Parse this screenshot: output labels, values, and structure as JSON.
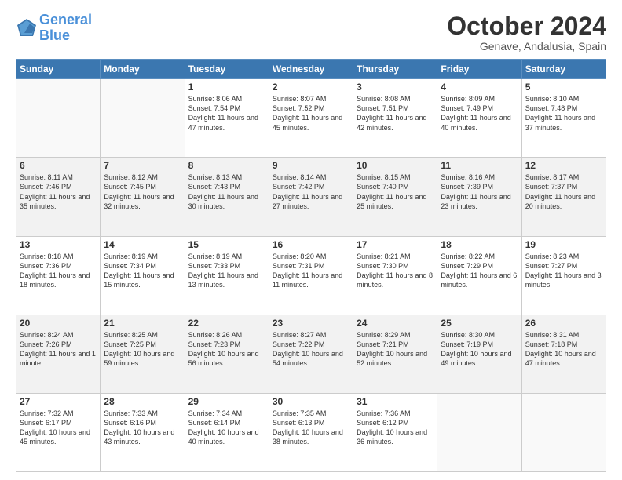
{
  "header": {
    "logo_line1": "General",
    "logo_line2": "Blue",
    "month_title": "October 2024",
    "subtitle": "Genave, Andalusia, Spain"
  },
  "weekdays": [
    "Sunday",
    "Monday",
    "Tuesday",
    "Wednesday",
    "Thursday",
    "Friday",
    "Saturday"
  ],
  "weeks": [
    [
      {
        "day": "",
        "info": ""
      },
      {
        "day": "",
        "info": ""
      },
      {
        "day": "1",
        "info": "Sunrise: 8:06 AM\nSunset: 7:54 PM\nDaylight: 11 hours and 47 minutes."
      },
      {
        "day": "2",
        "info": "Sunrise: 8:07 AM\nSunset: 7:52 PM\nDaylight: 11 hours and 45 minutes."
      },
      {
        "day": "3",
        "info": "Sunrise: 8:08 AM\nSunset: 7:51 PM\nDaylight: 11 hours and 42 minutes."
      },
      {
        "day": "4",
        "info": "Sunrise: 8:09 AM\nSunset: 7:49 PM\nDaylight: 11 hours and 40 minutes."
      },
      {
        "day": "5",
        "info": "Sunrise: 8:10 AM\nSunset: 7:48 PM\nDaylight: 11 hours and 37 minutes."
      }
    ],
    [
      {
        "day": "6",
        "info": "Sunrise: 8:11 AM\nSunset: 7:46 PM\nDaylight: 11 hours and 35 minutes."
      },
      {
        "day": "7",
        "info": "Sunrise: 8:12 AM\nSunset: 7:45 PM\nDaylight: 11 hours and 32 minutes."
      },
      {
        "day": "8",
        "info": "Sunrise: 8:13 AM\nSunset: 7:43 PM\nDaylight: 11 hours and 30 minutes."
      },
      {
        "day": "9",
        "info": "Sunrise: 8:14 AM\nSunset: 7:42 PM\nDaylight: 11 hours and 27 minutes."
      },
      {
        "day": "10",
        "info": "Sunrise: 8:15 AM\nSunset: 7:40 PM\nDaylight: 11 hours and 25 minutes."
      },
      {
        "day": "11",
        "info": "Sunrise: 8:16 AM\nSunset: 7:39 PM\nDaylight: 11 hours and 23 minutes."
      },
      {
        "day": "12",
        "info": "Sunrise: 8:17 AM\nSunset: 7:37 PM\nDaylight: 11 hours and 20 minutes."
      }
    ],
    [
      {
        "day": "13",
        "info": "Sunrise: 8:18 AM\nSunset: 7:36 PM\nDaylight: 11 hours and 18 minutes."
      },
      {
        "day": "14",
        "info": "Sunrise: 8:19 AM\nSunset: 7:34 PM\nDaylight: 11 hours and 15 minutes."
      },
      {
        "day": "15",
        "info": "Sunrise: 8:19 AM\nSunset: 7:33 PM\nDaylight: 11 hours and 13 minutes."
      },
      {
        "day": "16",
        "info": "Sunrise: 8:20 AM\nSunset: 7:31 PM\nDaylight: 11 hours and 11 minutes."
      },
      {
        "day": "17",
        "info": "Sunrise: 8:21 AM\nSunset: 7:30 PM\nDaylight: 11 hours and 8 minutes."
      },
      {
        "day": "18",
        "info": "Sunrise: 8:22 AM\nSunset: 7:29 PM\nDaylight: 11 hours and 6 minutes."
      },
      {
        "day": "19",
        "info": "Sunrise: 8:23 AM\nSunset: 7:27 PM\nDaylight: 11 hours and 3 minutes."
      }
    ],
    [
      {
        "day": "20",
        "info": "Sunrise: 8:24 AM\nSunset: 7:26 PM\nDaylight: 11 hours and 1 minute."
      },
      {
        "day": "21",
        "info": "Sunrise: 8:25 AM\nSunset: 7:25 PM\nDaylight: 10 hours and 59 minutes."
      },
      {
        "day": "22",
        "info": "Sunrise: 8:26 AM\nSunset: 7:23 PM\nDaylight: 10 hours and 56 minutes."
      },
      {
        "day": "23",
        "info": "Sunrise: 8:27 AM\nSunset: 7:22 PM\nDaylight: 10 hours and 54 minutes."
      },
      {
        "day": "24",
        "info": "Sunrise: 8:29 AM\nSunset: 7:21 PM\nDaylight: 10 hours and 52 minutes."
      },
      {
        "day": "25",
        "info": "Sunrise: 8:30 AM\nSunset: 7:19 PM\nDaylight: 10 hours and 49 minutes."
      },
      {
        "day": "26",
        "info": "Sunrise: 8:31 AM\nSunset: 7:18 PM\nDaylight: 10 hours and 47 minutes."
      }
    ],
    [
      {
        "day": "27",
        "info": "Sunrise: 7:32 AM\nSunset: 6:17 PM\nDaylight: 10 hours and 45 minutes."
      },
      {
        "day": "28",
        "info": "Sunrise: 7:33 AM\nSunset: 6:16 PM\nDaylight: 10 hours and 43 minutes."
      },
      {
        "day": "29",
        "info": "Sunrise: 7:34 AM\nSunset: 6:14 PM\nDaylight: 10 hours and 40 minutes."
      },
      {
        "day": "30",
        "info": "Sunrise: 7:35 AM\nSunset: 6:13 PM\nDaylight: 10 hours and 38 minutes."
      },
      {
        "day": "31",
        "info": "Sunrise: 7:36 AM\nSunset: 6:12 PM\nDaylight: 10 hours and 36 minutes."
      },
      {
        "day": "",
        "info": ""
      },
      {
        "day": "",
        "info": ""
      }
    ]
  ]
}
